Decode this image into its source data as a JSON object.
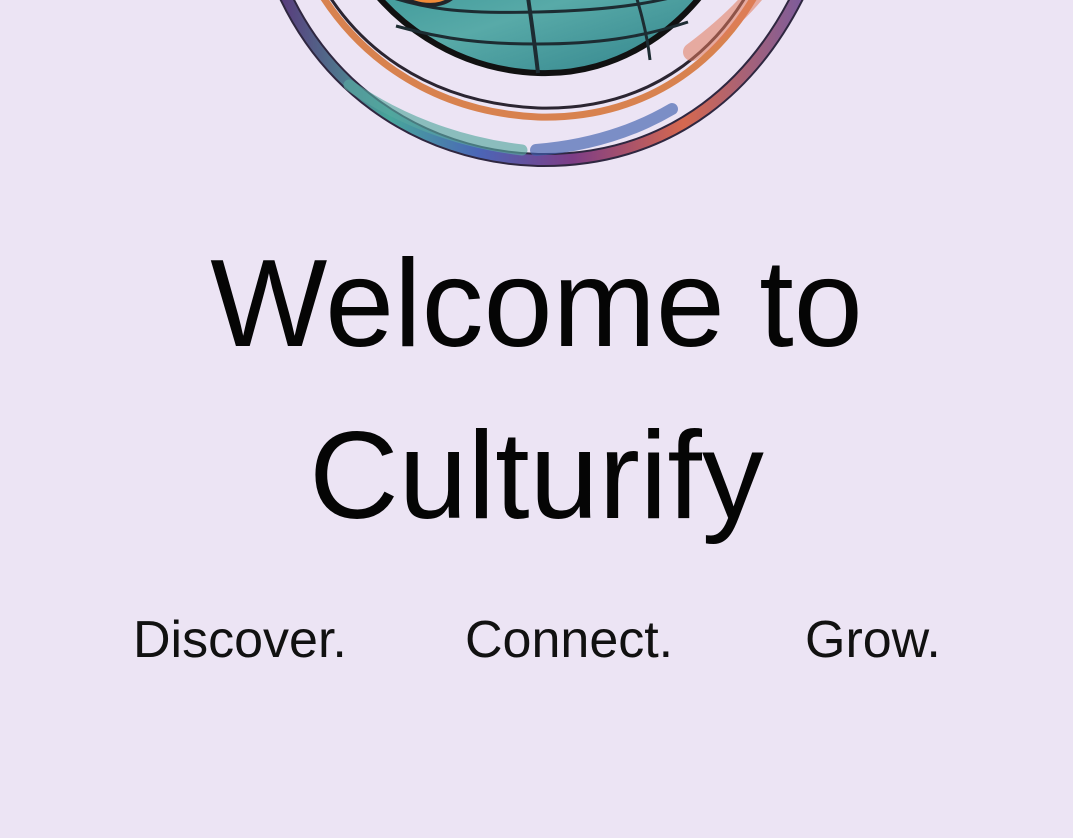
{
  "welcome": {
    "title_line_1": "Welcome to",
    "title_line_2": "Culturify"
  },
  "tagline": {
    "items": [
      "Discover.",
      "Connect.",
      "Grow."
    ]
  },
  "logo": {
    "icon": "globe-logo-icon"
  },
  "colors": {
    "background": "#ece4f4",
    "text": "#050505",
    "globe_ocean": "#4da6a3",
    "globe_land": "#f28b38",
    "ring_orange": "#d9824f",
    "ring_blue": "#4b66b7",
    "ring_purple": "#8e4b8f"
  }
}
